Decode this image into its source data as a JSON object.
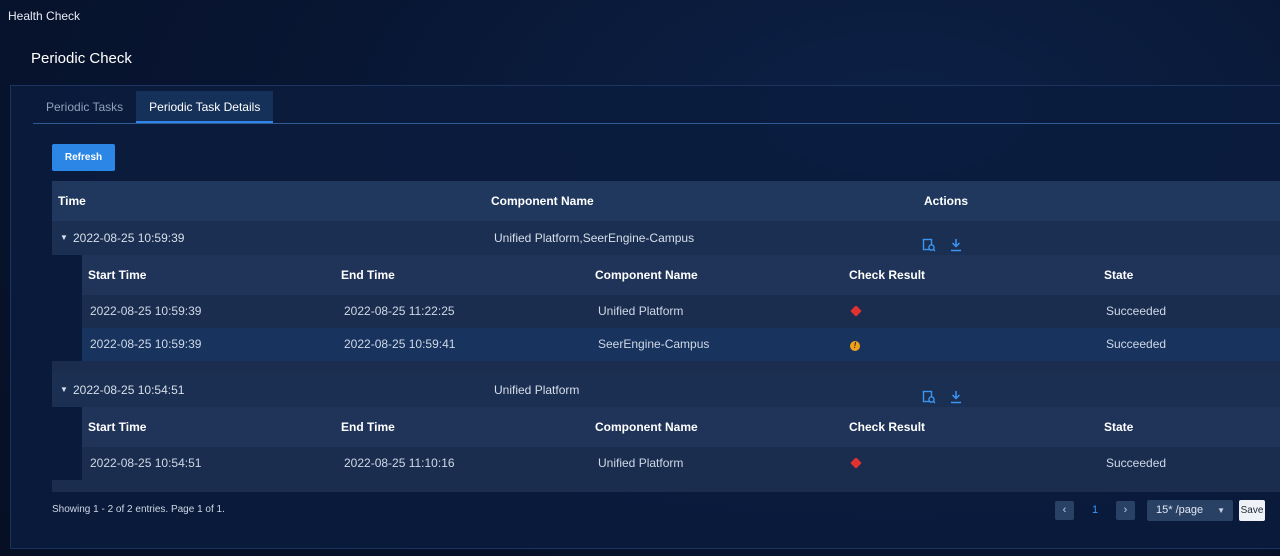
{
  "app": {
    "title": "Health Check"
  },
  "page": {
    "title": "Periodic Check"
  },
  "tabs": [
    {
      "label": "Periodic Tasks",
      "active": false
    },
    {
      "label": "Periodic Task Details",
      "active": true
    }
  ],
  "toolbar": {
    "refresh_label": "Refresh"
  },
  "table": {
    "columns": {
      "time": "Time",
      "component": "Component Name",
      "actions": "Actions"
    },
    "sub_columns": {
      "start": "Start Time",
      "end": "End Time",
      "component": "Component Name",
      "result": "Check Result",
      "state": "State"
    },
    "groups": [
      {
        "time": "2022-08-25 10:59:39",
        "component": "Unified Platform,SeerEngine-Campus",
        "actions": [
          "report-view-icon",
          "download-icon"
        ],
        "rows": [
          {
            "start": "2022-08-25 10:59:39",
            "end": "2022-08-25 11:22:25",
            "component": "Unified Platform",
            "result": "error",
            "state": "Succeeded"
          },
          {
            "start": "2022-08-25 10:59:39",
            "end": "2022-08-25 10:59:41",
            "component": "SeerEngine-Campus",
            "result": "warning",
            "state": "Succeeded"
          }
        ]
      },
      {
        "time": "2022-08-25 10:54:51",
        "component": "Unified Platform",
        "actions": [
          "report-view-icon",
          "download-icon"
        ],
        "rows": [
          {
            "start": "2022-08-25 10:54:51",
            "end": "2022-08-25 11:10:16",
            "component": "Unified Platform",
            "result": "error",
            "state": "Succeeded"
          }
        ]
      }
    ]
  },
  "footer": {
    "summary": "Showing 1 - 2 of 2 entries. Page 1 of 1."
  },
  "pagination": {
    "prev": "‹",
    "next": "›",
    "current_page": "1",
    "page_size": "15* /page",
    "save_label": "Save"
  },
  "colors": {
    "accent": "#2b86e5",
    "error": "#e0322f",
    "warning": "#f0a11c"
  }
}
